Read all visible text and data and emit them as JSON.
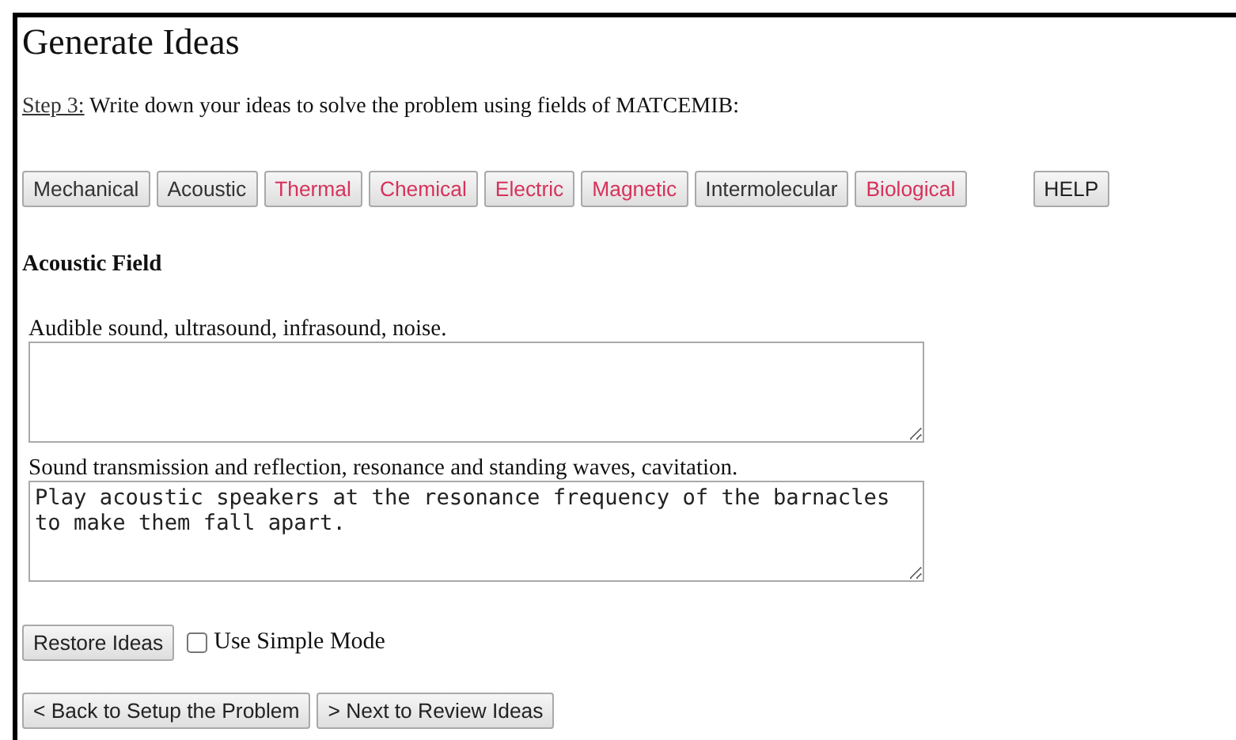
{
  "title": "Generate Ideas",
  "step": {
    "label": "Step 3:",
    "text": "Write down your ideas to solve the problem using fields of MATCEMIB:"
  },
  "fields": [
    {
      "label": "Mechanical",
      "color": "#333333"
    },
    {
      "label": "Acoustic",
      "color": "#333333"
    },
    {
      "label": "Thermal",
      "color": "#d6325a"
    },
    {
      "label": "Chemical",
      "color": "#d6325a"
    },
    {
      "label": "Electric",
      "color": "#d6325a"
    },
    {
      "label": "Magnetic",
      "color": "#d6325a"
    },
    {
      "label": "Intermolecular",
      "color": "#333333"
    },
    {
      "label": "Biological",
      "color": "#d6325a"
    }
  ],
  "help_button": "HELP",
  "section_title": "Acoustic Field",
  "prompts": [
    {
      "label": "Audible sound, ultrasound, infrasound, noise."
    },
    {
      "label": "Sound transmission and reflection, resonance and standing waves, cavitation.",
      "value": "Play acoustic speakers at the resonance frequency of the barnacles to make them fall apart."
    }
  ],
  "restore_button": "Restore Ideas",
  "simple_mode": {
    "label": "Use Simple Mode",
    "checked": false
  },
  "nav_buttons": [
    "< Back to Setup the Problem",
    "> Next to Review Ideas"
  ]
}
